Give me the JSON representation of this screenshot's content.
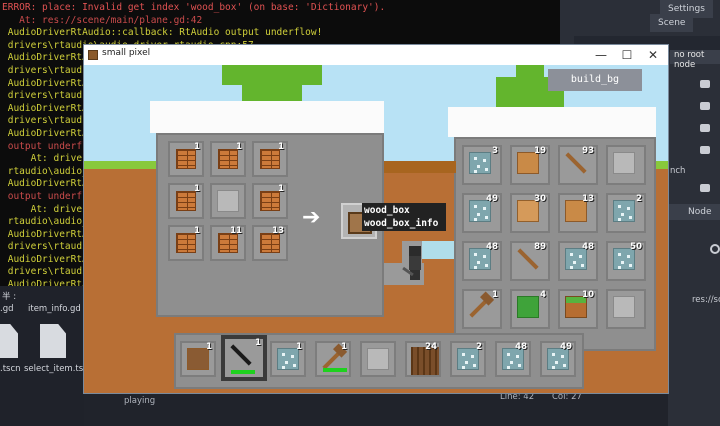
{
  "console": {
    "lines": [
      {
        "t": "ERROR: place: Invalid get index 'wood_box' (on base: 'Dictionary').",
        "c": "err"
      },
      {
        "t": "   At: res://scene/main/plane.gd:42",
        "c": "red"
      },
      {
        "t": " AudioDriverRtAudio::callback: RtAudio output underflow!",
        "c": ""
      },
      {
        "t": " drivers\\rtaudio\\audio_driver_rtaudio.cpp:57",
        "c": ""
      },
      {
        "t": " AudioDriverRtAu",
        "c": ""
      },
      {
        "t": " drivers\\rtaudio",
        "c": ""
      },
      {
        "t": " AudioDriverRtAu",
        "c": ""
      },
      {
        "t": " drivers\\rtaudio",
        "c": ""
      },
      {
        "t": " AudioDriverRtAu",
        "c": ""
      },
      {
        "t": " drivers\\rtaudio",
        "c": ""
      },
      {
        "t": " AudioDriverRtAu",
        "c": ""
      },
      {
        "t": " output underflo",
        "c": "red"
      },
      {
        "t": "     At: drivers",
        "c": ""
      },
      {
        "t": " rtaudio\\audio_dr",
        "c": ""
      },
      {
        "t": " AudioDriverRtAu",
        "c": ""
      },
      {
        "t": " output underflo",
        "c": "red"
      },
      {
        "t": "     At: drivers",
        "c": ""
      },
      {
        "t": " rtaudio\\audio_dr",
        "c": ""
      },
      {
        "t": " AudioDriverRtAu",
        "c": ""
      },
      {
        "t": " drivers\\rtaudio",
        "c": ""
      },
      {
        "t": " AudioDriverRtAu",
        "c": ""
      },
      {
        "t": " drivers\\rtaudio",
        "c": ""
      },
      {
        "t": " AudioDriverRtAu",
        "c": ""
      },
      {
        "t": " drivers\\rtaudio",
        "c": ""
      },
      {
        "t": " AudioDriverRtAu",
        "c": ""
      },
      {
        "t": " drivers\\rtaudio",
        "c": ""
      }
    ]
  },
  "editor": {
    "settings_tab": "Settings",
    "scene_tab": "Scene",
    "no_root": "no root node",
    "node_tab": "Node",
    "side_text_1": "nch",
    "side_text_2": "res://sc"
  },
  "files": {
    "tab_label": "半 :",
    "file1": ".gd",
    "file2": "item_info.gd",
    "file3": ".tscn",
    "file4": "select_item.tscn"
  },
  "status": {
    "line": "Line: 42",
    "col": "Col: 27",
    "left": "playing"
  },
  "window": {
    "title": "small pixel",
    "min": "—",
    "max": "☐",
    "close": "✕"
  },
  "game": {
    "build_button": "build_bg",
    "tooltip": {
      "line1": "wood_box",
      "line2": "wood_box_info"
    },
    "arrow": "➔",
    "craft": [
      {
        "type": "bricks",
        "count": "1"
      },
      {
        "type": "bricks",
        "count": "1"
      },
      {
        "type": "bricks",
        "count": "1"
      },
      {
        "type": "bricks",
        "count": "1"
      },
      {
        "type": "stone",
        "count": ""
      },
      {
        "type": "bricks",
        "count": "1"
      },
      {
        "type": "bricks",
        "count": "1"
      },
      {
        "type": "bricks",
        "count": "11"
      },
      {
        "type": "bricks",
        "count": "13"
      }
    ],
    "inventory": [
      {
        "type": "ore",
        "count": "3"
      },
      {
        "type": "plank",
        "count": "19"
      },
      {
        "type": "stick",
        "count": "93"
      },
      {
        "type": "stone",
        "count": ""
      },
      {
        "type": "ore",
        "count": "49"
      },
      {
        "type": "plank2",
        "count": "30"
      },
      {
        "type": "plank",
        "count": "13"
      },
      {
        "type": "ore",
        "count": "2"
      },
      {
        "type": "ore",
        "count": "48"
      },
      {
        "type": "stick",
        "count": "89"
      },
      {
        "type": "ore",
        "count": "48"
      },
      {
        "type": "ore",
        "count": "50"
      },
      {
        "type": "axe",
        "count": "1"
      },
      {
        "type": "grass",
        "count": "4"
      },
      {
        "type": "gdirt",
        "count": "10"
      },
      {
        "type": "stone",
        "count": ""
      }
    ],
    "hotbar": [
      {
        "type": "box",
        "count": "1",
        "bar": false
      },
      {
        "type": "pickaxe",
        "count": "1",
        "bar": true
      },
      {
        "type": "ore",
        "count": "1",
        "bar": false
      },
      {
        "type": "shovel",
        "count": "1",
        "bar": true
      },
      {
        "type": "stone",
        "count": "",
        "bar": false
      },
      {
        "type": "log",
        "count": "24",
        "bar": false
      },
      {
        "type": "ore",
        "count": "2",
        "bar": false
      },
      {
        "type": "ore",
        "count": "48",
        "bar": false
      },
      {
        "type": "ore",
        "count": "49",
        "bar": false
      }
    ],
    "colors": {
      "sky": "#b8e2f5",
      "dirt": "#b86f35",
      "grass": "#88c93c",
      "stone_house": "#8f8f8f",
      "inventory_panel": "#8f8f8f",
      "hotbar_panel": "#8f8f8f",
      "hotbar_selected": "#3a3a3a"
    }
  }
}
